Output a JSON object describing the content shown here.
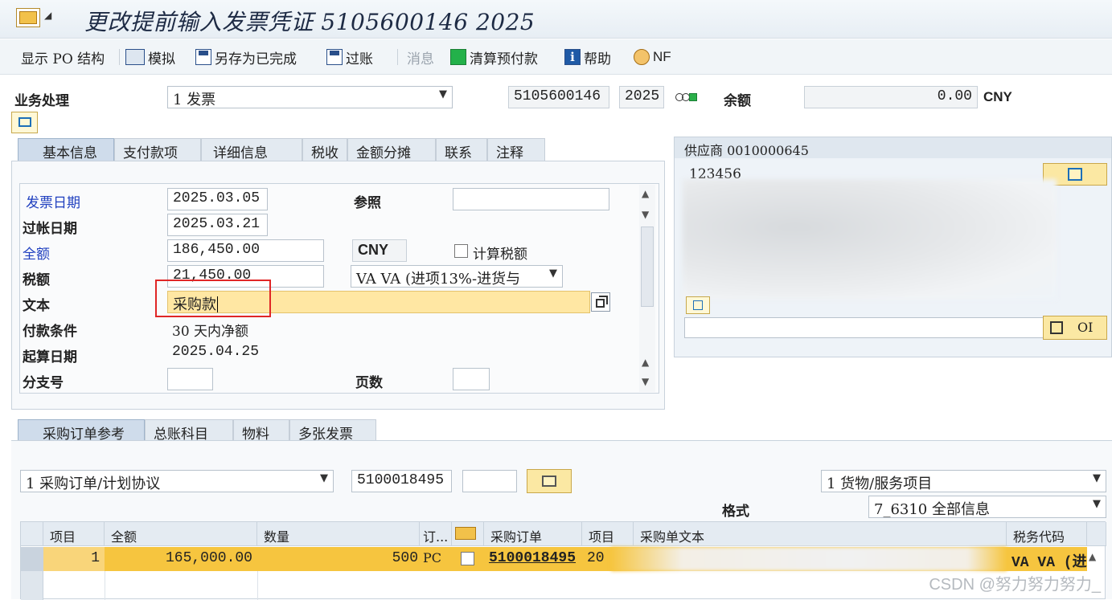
{
  "window": {
    "title": "更改提前输入发票凭证 5105600146 2025"
  },
  "toolbar": {
    "items": [
      {
        "label": "显示 PO 结构",
        "icon": "none"
      },
      {
        "label": "模拟",
        "icon": "simulate-icon"
      },
      {
        "label": "另存为已完成",
        "icon": "save-icon"
      },
      {
        "label": "过账",
        "icon": "save-icon"
      },
      {
        "label": "消息",
        "icon": "none",
        "disabled": true
      },
      {
        "label": "清算预付款",
        "icon": "green-square-icon"
      },
      {
        "label": "帮助",
        "icon": "info-icon"
      },
      {
        "label": "NF",
        "icon": "nf-icon"
      }
    ]
  },
  "header": {
    "transaction_label": "业务处理",
    "transaction_value": "1 发票",
    "doc_number": "5105600146",
    "fiscal_year": "2025",
    "balance_label": "余额",
    "balance_value": "0.00",
    "balance_currency": "CNY"
  },
  "tabs": [
    "基本信息",
    "支付款项",
    "详细信息",
    "税收",
    "金额分摊",
    "联系",
    "注释"
  ],
  "basic": {
    "invoice_date_label": "发票日期",
    "invoice_date": "2025.03.05",
    "reference_label": "参照",
    "reference": "",
    "posting_date_label": "过帐日期",
    "posting_date": "2025.03.21",
    "amount_label": "全额",
    "amount": "186,450.00",
    "currency": "CNY",
    "calc_tax_label": "计算税额",
    "tax_label": "税额",
    "tax_amount": "21,450.00",
    "tax_code": "VA VA (进项13%-进货与",
    "text_label": "文本",
    "text_value": "采购款",
    "payment_terms_label": "付款条件",
    "payment_terms": "30 天内净额",
    "baseline_date_label": "起算日期",
    "baseline_date": "2025.04.25",
    "branch_label": "分支号",
    "branch": "",
    "pages_label": "页数",
    "pages": ""
  },
  "vendor": {
    "header": "供应商 0010000645",
    "name": "123456",
    "oi_label": "OI"
  },
  "bottom_tabs": [
    "采购订单参考",
    "总账科目",
    "物料",
    "多张发票"
  ],
  "po_ref": {
    "ref_type": "1 采购订单/计划协议",
    "po_number": "5100018495",
    "extra": "",
    "item_type": "1 货物/服务项目",
    "layout_label": "格式",
    "layout_value": "7_6310 全部信息"
  },
  "table": {
    "columns": [
      "项目",
      "全额",
      "数量",
      "订...",
      "",
      "采购订单",
      "项目",
      "采购单文本",
      "税务代码"
    ],
    "rows": [
      {
        "item": "1",
        "amount": "165,000.00",
        "quantity": "500",
        "unit": "PC",
        "po": "5100018495",
        "po_item": "20",
        "text": "",
        "tax_code": "VA VA (进"
      }
    ]
  },
  "watermark": "CSDN @努力努力努力_"
}
